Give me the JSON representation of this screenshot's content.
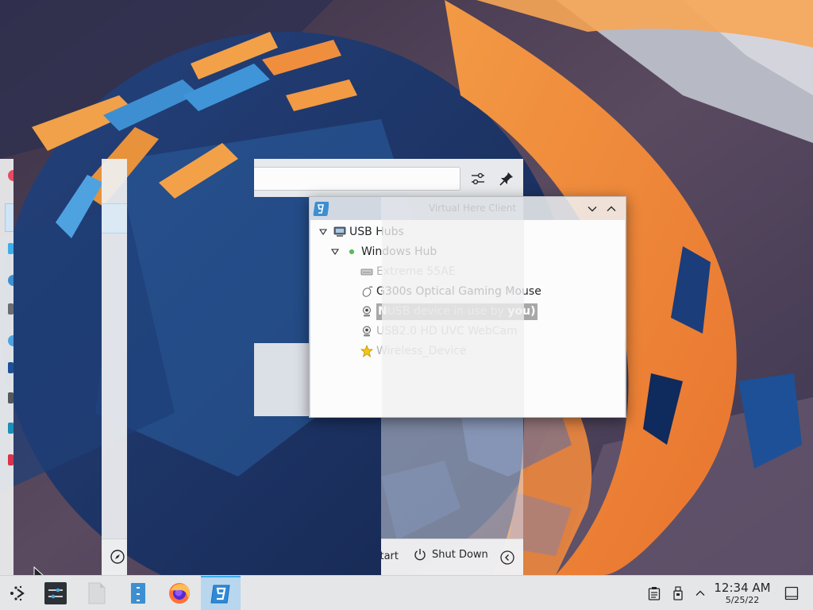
{
  "usb_window": {
    "title": "Virtual Here Client",
    "tree": {
      "root": {
        "label": "USB Hubs",
        "icon": "computer-icon"
      },
      "hub": {
        "label": "Windows Hub",
        "icon": "green-dot-icon"
      },
      "devices": [
        {
          "label": "Extreme 55AE",
          "icon": "drive-icon",
          "faded": true
        },
        {
          "label": "G300s Optical Gaming Mouse",
          "icon": "mouse-icon",
          "faded": false
        },
        {
          "label_start": "N",
          "label_mid": "USB device in use by ",
          "label_end": "you)",
          "icon": "webcam-icon",
          "selected": true
        },
        {
          "label": "USB2.0 HD UVC WebCam",
          "icon": "webcam-icon",
          "faded": true
        },
        {
          "label": "Wireless_Device",
          "icon": "star-icon",
          "faded": true
        }
      ]
    }
  },
  "launcher": {
    "restart_label": "Restart",
    "shutdown_label": "Shut Down"
  },
  "taskbar": {
    "items": [
      {
        "name": "application-launcher",
        "icon": "kde-launcher-icon"
      },
      {
        "name": "system-settings",
        "icon": "settings-sliders-icon"
      },
      {
        "name": "files",
        "icon": "document-icon"
      },
      {
        "name": "dolphin",
        "icon": "file-manager-icon"
      },
      {
        "name": "firefox",
        "icon": "firefox-icon"
      },
      {
        "name": "virtualhere",
        "icon": "virtualhere-icon",
        "active": true
      }
    ],
    "tray": [
      "clipboard-icon",
      "usb-device-icon",
      "expand-tray-icon",
      "show-desktop-icon"
    ],
    "clock": {
      "time": "12:34 AM",
      "date": "5/25/22"
    }
  },
  "colors": {
    "accent": "#3daee9",
    "selection_grey": "#a8a8a8",
    "panel_bg": "#e4e6e8",
    "wallpaper_orange": "#f0883e",
    "wallpaper_blue": "#2a5fa0"
  }
}
